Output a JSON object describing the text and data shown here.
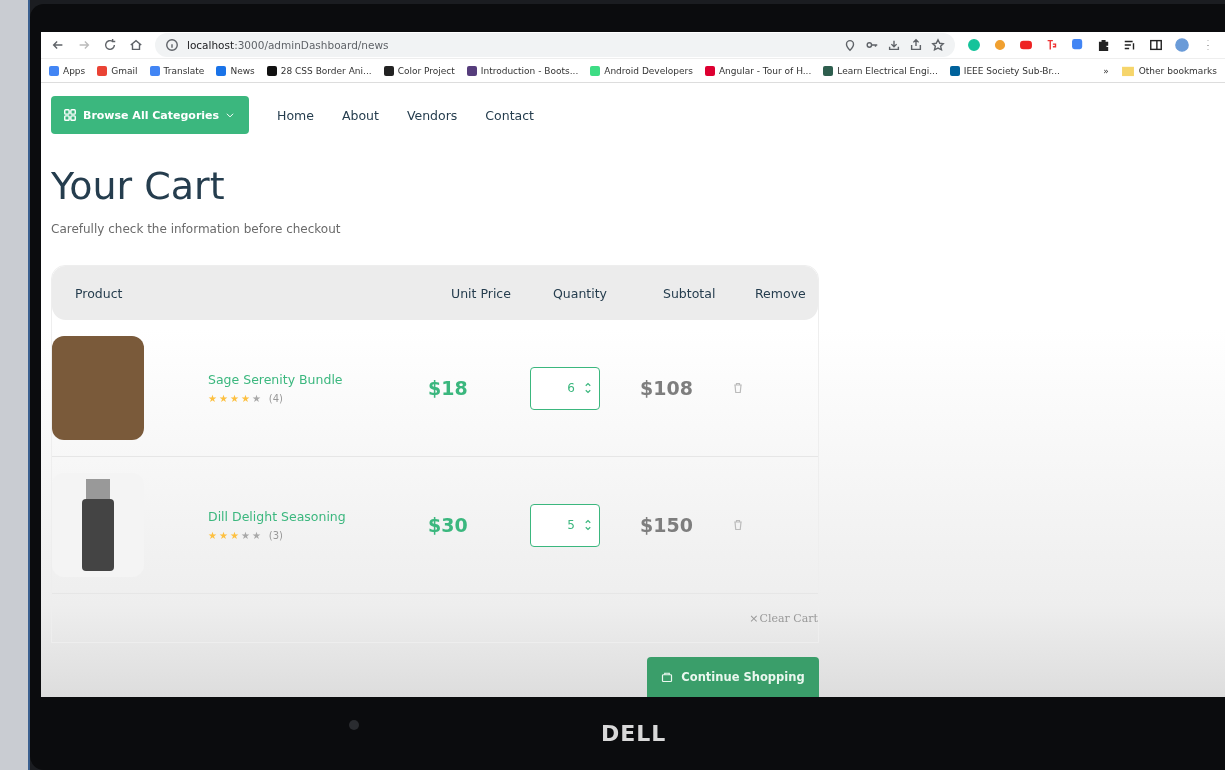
{
  "browser": {
    "url_host": "localhost",
    "url_path": ":3000/adminDashboard/news",
    "bookmarks": [
      {
        "label": "Apps",
        "color": "#4285f4"
      },
      {
        "label": "Gmail",
        "color": "#ea4335"
      },
      {
        "label": "Translate",
        "color": "#4285f4"
      },
      {
        "label": "News",
        "color": "#1a73e8"
      },
      {
        "label": "28 CSS Border Ani...",
        "color": "#111111"
      },
      {
        "label": "Color Project",
        "color": "#222222"
      },
      {
        "label": "Introduction - Boots...",
        "color": "#563d7c"
      },
      {
        "label": "Android Developers",
        "color": "#3ddc84"
      },
      {
        "label": "Angular - Tour of H...",
        "color": "#dd0031"
      },
      {
        "label": "Learn Electrical Engi...",
        "color": "#2e5e4e"
      },
      {
        "label": "IEEE Society Sub-Br...",
        "color": "#00629b"
      }
    ],
    "more": "»",
    "other_bookmarks": "Other bookmarks"
  },
  "nav": {
    "categories_button": "Browse All Categories",
    "links": [
      "Home",
      "About",
      "Vendors",
      "Contact"
    ]
  },
  "cart": {
    "title": "Your Cart",
    "subtitle": "Carefully check the information before checkout",
    "columns": [
      "Product",
      "Unit Price",
      "Quantity",
      "Subtotal",
      "Remove"
    ],
    "rows": [
      {
        "kind": "bundle",
        "name": "Sage Serenity Bundle",
        "stars": 4,
        "reviews": "(4)",
        "price": "$18",
        "quantity": "6",
        "subtotal": "$108"
      },
      {
        "kind": "jar",
        "name": "Dill Delight Seasoning",
        "stars": 3,
        "reviews": "(3)",
        "price": "$30",
        "quantity": "5",
        "subtotal": "$150"
      }
    ],
    "clear_mark": "×",
    "clear_label": "Clear Cart",
    "continue_button": "Continue Shopping"
  },
  "laptop": {
    "brand": "DELL"
  }
}
